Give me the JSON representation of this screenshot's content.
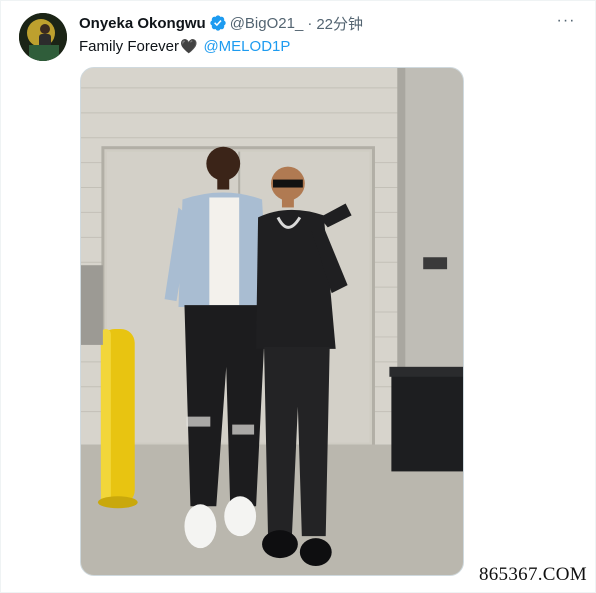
{
  "tweet": {
    "author_name": "Onyeka Okongwu",
    "handle": "@BigO21_",
    "separator": "·",
    "time": "22分钟",
    "text": "Family Forever",
    "emoji": "🖤",
    "mention": "@MELOD1P",
    "more_label": "···"
  },
  "watermark": "865367.COM",
  "icons": {
    "verified": "verified-badge-icon",
    "more": "more-options-icon"
  },
  "colors": {
    "link": "#1d9bf0",
    "secondary_text": "#536471",
    "verified": "#1d9bf0"
  }
}
